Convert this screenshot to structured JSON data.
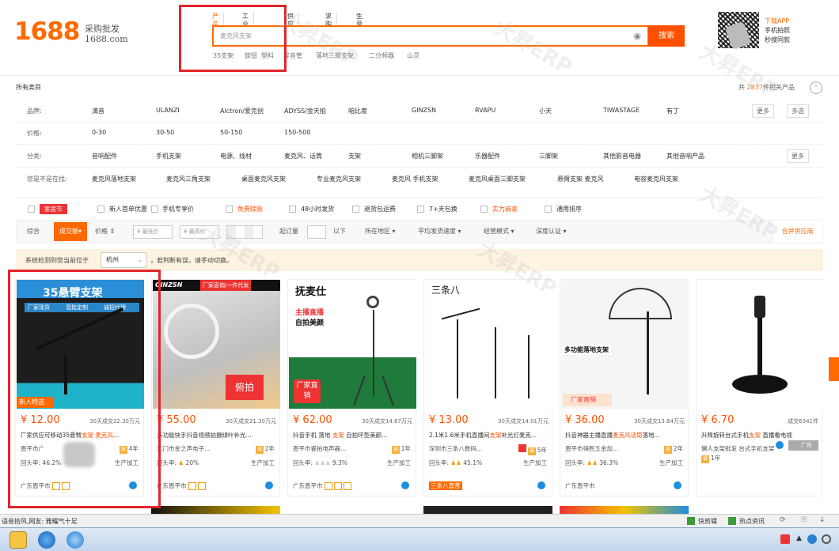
{
  "header": {
    "logo": "1688",
    "logo_sub": "采购批发",
    "logo_url": "1688.com",
    "tabs": [
      "产品",
      "工业品牌",
      "供应商",
      "求购",
      "生意经"
    ],
    "search_placeholder": "麦克风支架",
    "search_button": "搜索",
    "hot_words": [
      "35支架",
      "旋钮",
      "塑料",
      "导音管",
      "落地三脚支架",
      "二分频器",
      "山灵"
    ],
    "download_title": "下载APP",
    "download_line1": "手机拍照",
    "download_line2": "秒搜同款"
  },
  "breadcrumb": "所有类目",
  "total": {
    "prefix": "共",
    "count": "2877",
    "suffix": "件相关产品"
  },
  "filters": {
    "brand": {
      "label": "品牌:",
      "items": [
        "漓音",
        "ULANZI",
        "Alctron/爱克创",
        "ADYSS/金天拍",
        "咱比度",
        "GINZSN",
        "RVAPU",
        "小天",
        "TIWASTAGE",
        "有丁"
      ],
      "more": "更多",
      "multi": "多选"
    },
    "price": {
      "label": "价格:",
      "items": [
        "0-30",
        "30-50",
        "50-150",
        "150-500"
      ]
    },
    "category": {
      "label": "分类:",
      "items": [
        "音响配件",
        "手机支架",
        "电源、线材",
        "麦克风、话筒",
        "支架",
        "相机三脚架",
        "乐器配件",
        "三脚架",
        "其他影音电器",
        "其他音响产品"
      ],
      "more": "更多"
    },
    "related": {
      "label": "您是不是在找:",
      "items": [
        "麦克风落地支架",
        "麦克风三角支架",
        "桌面麦克风支架",
        "专业麦克风支架",
        "麦克风 手机支架",
        "麦克风桌面三脚支架",
        "悬臂支架 麦克风",
        "电容麦克风支架"
      ]
    }
  },
  "options": {
    "tag": "家居节",
    "checks": [
      "新人首单优惠",
      "手机专享价",
      "免费赊账",
      "48小时发货",
      "退货包运费",
      "7+天包换",
      "实力商家",
      "通用排序"
    ]
  },
  "sortbar": {
    "items": [
      "综合",
      "成交额",
      "价格"
    ],
    "price_min": "¥ 最低价",
    "price_max": "¥ 最高价",
    "moq_label": "起订量",
    "moq_unit": "以下",
    "dropdowns": [
      "所在地区",
      "平均发货速度",
      "经营模式",
      "深度认证"
    ],
    "merge": "合并供应商"
  },
  "location": {
    "prefix": "系统检测到您当前位于",
    "city": "杭州",
    "suffix": "，若判断有误，请手动切换。"
  },
  "products": [
    {
      "img_title": "35悬臂支架",
      "img_tags": [
        "厂家现货",
        "混批定制",
        "诚招代理"
      ],
      "img_corner": "新人特选",
      "price": "¥ 12.00",
      "sold": "30天成交22.30万元",
      "title_pre": "厂家供应可移动35悬臂",
      "title_kw": "支架 麦克风",
      "title_post": "...",
      "shop": "恩平市广",
      "years": "4年",
      "return": "回头率:",
      "return_pct": "46.2%",
      "kind": "生产加工",
      "area": "广东恩平市"
    },
    {
      "img_title": "GINZSN",
      "img_tags": [
        "厂家直销/一件代发"
      ],
      "img_corner": "俯拍",
      "price": "¥ 55.00",
      "sold": "30天成交21.30万元",
      "title_pre": "多功能快手抖音视频拍摄绿叶补光...",
      "title_kw": "",
      "title_post": "",
      "shop": "江门市金之声电子...",
      "years": "2年",
      "return": "回头率:",
      "return_pct": "20%",
      "kind": "生产加工",
      "area": "广东恩平市"
    },
    {
      "img_title": "抚麦仕",
      "img_tags": [
        "主播直播",
        "自拍美颜"
      ],
      "img_corner": "厂家直销",
      "price": "¥ 62.00",
      "sold": "30天成交14.67万元",
      "title_pre": "抖音手机 落地 ",
      "title_kw": "支架",
      "title_post": " 自拍环型美颜...",
      "shop": "恩平市睿拍电声器...",
      "years": "1年",
      "return": "回头率:",
      "return_pct": "9.3%",
      "kind": "生产加工",
      "area": "广东恩平市"
    },
    {
      "img_title": "三条八",
      "img_tags": [],
      "img_corner": "",
      "price": "¥ 13.00",
      "sold": "30天成交14.01万元",
      "title_pre": "2.1米1.6米手机直播间",
      "title_kw": "支架",
      "title_post": "补光灯麦克...",
      "shop": "深圳市三条八数码...",
      "years": "5年",
      "return": "回头率:",
      "return_pct": "45.1%",
      "kind": "生产加工",
      "area": "三条八直营"
    },
    {
      "img_title": "多功能落地支架",
      "img_tags": [],
      "img_corner": "厂家直销",
      "price": "¥ 36.00",
      "sold": "30天成交13.64万元",
      "title_pre": "抖音神器主播直播",
      "title_kw": "麦克风话筒",
      "title_post": "落地...",
      "shop": "恩平市得胜五金加...",
      "years": "2年",
      "return": "回头率:",
      "return_pct": "36.3%",
      "kind": "生产加工",
      "area": "广东恩平市"
    },
    {
      "img_title": "",
      "img_tags": [],
      "img_corner": "",
      "price": "¥ 6.70",
      "sold": "成交6341件",
      "title_pre": "升降旋转台式手机",
      "title_kw": "支架",
      "title_post": " 直播看电视",
      "title2": "懒人支架批发 台式手机支架",
      "shop": "",
      "years": "1年",
      "return": "",
      "return_pct": "",
      "kind": "",
      "area": "广告"
    }
  ],
  "statusbar": {
    "left": "语音拾风,网友: 雅耀气十足",
    "items": [
      "快剪辑",
      "热点资讯"
    ]
  },
  "taskbar": {
    "clock": ""
  },
  "watermark": "大昇ERP"
}
